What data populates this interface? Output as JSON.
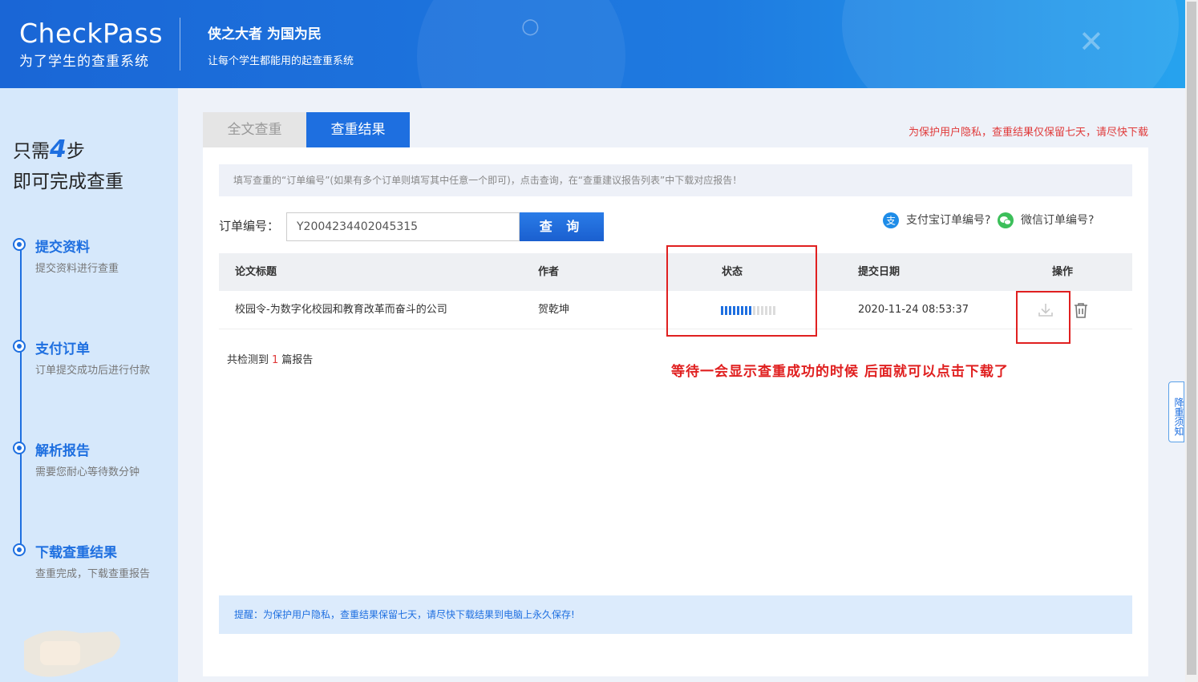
{
  "header": {
    "logo": "CheckPass",
    "logo_sub": "为了学生的查重系统",
    "slogan_title": "侠之大者 为国为民",
    "slogan_sub": "让每个学生都能用的起查重系统"
  },
  "sidebar": {
    "title_prefix": "只需",
    "title_num": "4",
    "title_suffix": "步",
    "title_line2": "即可完成查重",
    "steps": [
      {
        "name": "提交资料",
        "desc": "提交资料进行查重"
      },
      {
        "name": "支付订单",
        "desc": "订单提交成功后进行付款"
      },
      {
        "name": "解析报告",
        "desc": "需要您耐心等待数分钟"
      },
      {
        "name": "下载查重结果",
        "desc": "查重完成，下载查重报告"
      }
    ]
  },
  "tabs": [
    {
      "label": "全文查重",
      "active": false
    },
    {
      "label": "查重结果",
      "active": true
    }
  ],
  "privacy_note": "为保护用户隐私，查重结果仅保留七天，请尽快下载",
  "hint": "填写查重的“订单编号”(如果有多个订单则填写其中任意一个即可)，点击查询，在“查重建议报告列表”中下载对应报告！",
  "order": {
    "label": "订单编号：",
    "value": "Y2004234402045315",
    "query_button": "查 询"
  },
  "help_links": {
    "alipay": "支付宝订单编号?",
    "alipay_icon": "支",
    "wechat": "微信订单编号?"
  },
  "table": {
    "headers": [
      "论文标题",
      "作者",
      "状态",
      "提交日期",
      "操作"
    ],
    "rows": [
      {
        "title": "校园令-为数字化校园和教育改革而奋斗的公司",
        "author": "贺乾坤",
        "progress": 0.6,
        "date": "2020-11-24 08:53:37"
      }
    ]
  },
  "summary": {
    "prefix": "共检测到",
    "count": "1",
    "suffix": "篇报告"
  },
  "annotation": "等待一会显示查重成功的时候  后面就可以点击下载了",
  "reminder": "提醒：为保护用户隐私，查重结果保留七天，请尽快下载结果到电脑上永久保存!",
  "side_tab": "降重须知",
  "colors": {
    "primary": "#1e6fe0",
    "alert": "#e02020",
    "sidebar_bg": "#d6e8fb"
  },
  "icons": [
    "download-icon",
    "trash-icon",
    "alipay-icon",
    "wechat-icon"
  ]
}
